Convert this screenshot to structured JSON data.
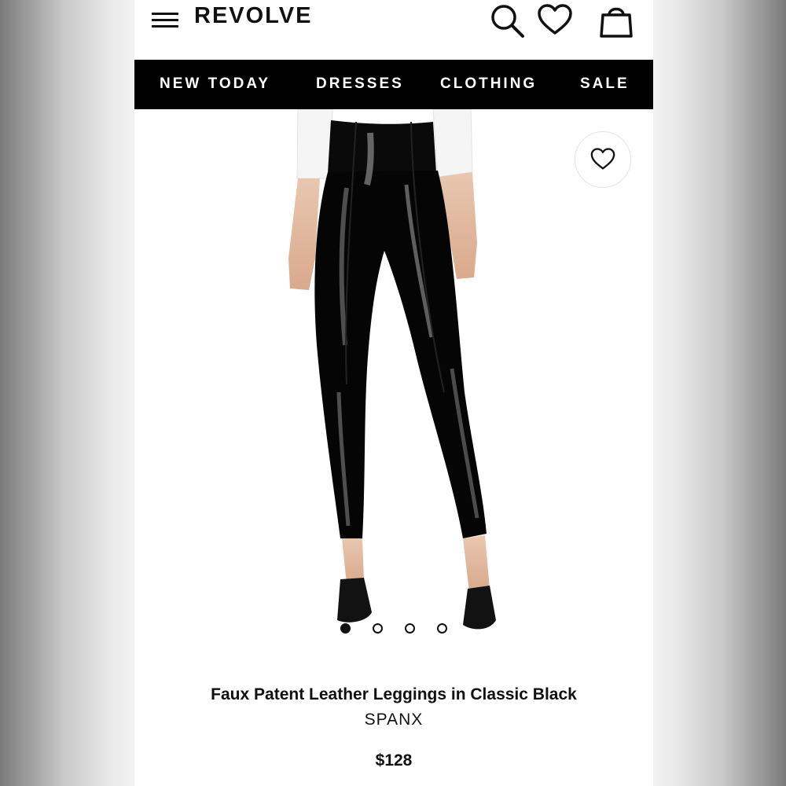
{
  "header": {
    "brand": "REVOLVE",
    "icons": [
      "menu-icon",
      "search-icon",
      "heart-icon",
      "shopping-bag-icon"
    ]
  },
  "nav": {
    "items": [
      {
        "label": "NEW TODAY"
      },
      {
        "label": "DRESSES"
      },
      {
        "label": "CLOTHING"
      },
      {
        "label": "SALE"
      }
    ]
  },
  "gallery": {
    "image": "black faux patent leather leggings on model",
    "slide_count": 4,
    "active_slide": 1,
    "favorite_icon": "heart-outline-icon"
  },
  "product": {
    "title": "Faux Patent Leather Leggings in Classic Black",
    "brand": "SPANX",
    "price": "$128"
  },
  "colors": {
    "nav_bg": "#000000",
    "text": "#111111",
    "background": "#ffffff"
  }
}
